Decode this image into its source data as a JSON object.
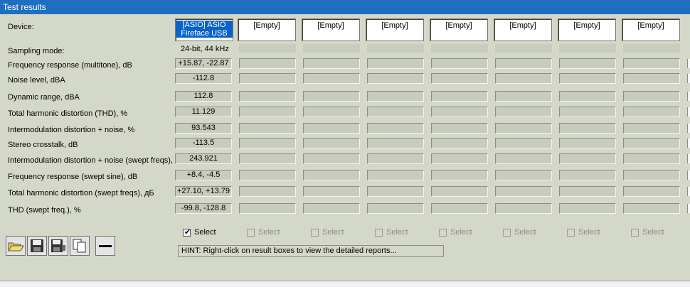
{
  "window": {
    "title": "Test results"
  },
  "labels": {
    "device": "Device:",
    "sampling_mode": "Sampling mode:",
    "rows": [
      "Frequency response (multitone), dB",
      "Noise level, dBA",
      "Dynamic range, dBA",
      "Total harmonic distortion (THD), %",
      "Intermodulation distortion + noise, %",
      "Stereo crosstalk, dB",
      "Intermodulation distortion + noise (swept freqs), %",
      "Frequency response (swept sine), dB",
      "Total harmonic distortion (swept freqs), дБ",
      "THD (swept freq.), %"
    ]
  },
  "devices": [
    {
      "line1": "[ASIO] ASIO",
      "line2": "Fireface USB"
    },
    {
      "line1": "[Empty]"
    },
    {
      "line1": "[Empty]"
    },
    {
      "line1": "[Empty]"
    },
    {
      "line1": "[Empty]"
    },
    {
      "line1": "[Empty]"
    },
    {
      "line1": "[Empty]"
    },
    {
      "line1": "[Empty]"
    }
  ],
  "sampling_value": "24-bit, 44 kHz",
  "results": {
    "col0": [
      "+15.87, -22.87",
      "-112.8",
      "112.8",
      "11.129",
      "93.543",
      "-113.5",
      "243.921",
      "+8.4, -4.5",
      "+27.10, +13.79",
      "-99.8, -128.8"
    ]
  },
  "select_label": "Select",
  "select_states": [
    true,
    false,
    false,
    false,
    false,
    false,
    false,
    false
  ],
  "toolbar": {
    "buttons": [
      {
        "icon": "open-folder-icon"
      },
      {
        "icon": "save-icon"
      },
      {
        "icon": "save-as-icon"
      },
      {
        "icon": "copy-icon"
      },
      {
        "icon": "minus-icon"
      }
    ]
  },
  "hint": "HINT: Right-click on result boxes to view the detailed reports..."
}
